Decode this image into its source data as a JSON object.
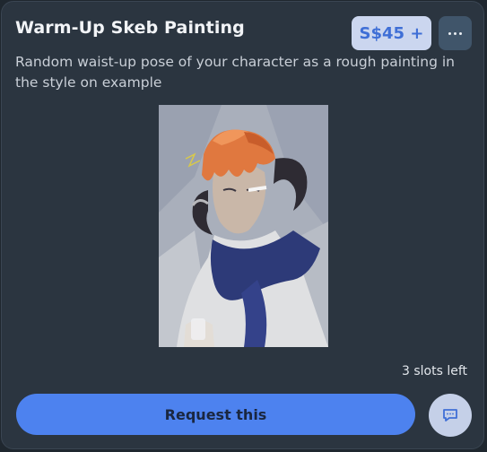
{
  "card": {
    "title": "Warm-Up Skeb Painting",
    "price": "S$45 +",
    "description": "Random waist-up pose of your character as a rough painting in the style on example",
    "slots_left": "3 slots left",
    "request_label": "Request this",
    "more_icon": "more-dots-icon",
    "chat_icon": "chat-icon"
  },
  "colors": {
    "card_bg": "#2b3540",
    "accent": "#4d82ef",
    "price_bg": "#cbd6ef",
    "price_text": "#3f6fd6"
  }
}
